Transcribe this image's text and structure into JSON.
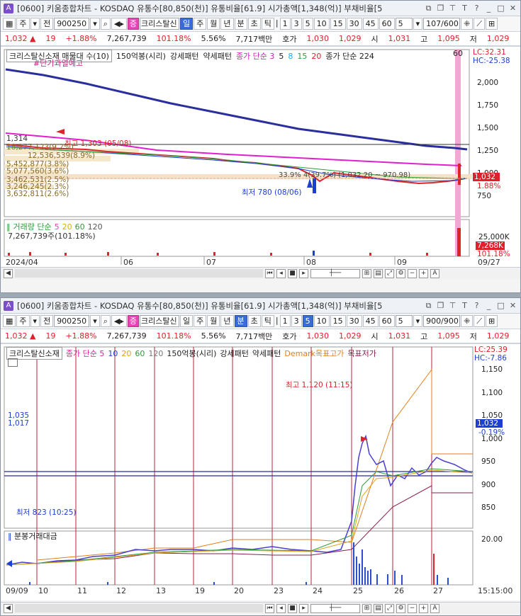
{
  "top": {
    "title": "[0600] 키움종합차트 - KOSDAQ 유통수[80,850(천)] 유통비율[61.9] 시가총액[1,348(억)] 부채비율[5",
    "toolbar": {
      "ju": "주",
      "jeon": "전",
      "code": "900250",
      "name": "크리스탈신",
      "periods": [
        "일",
        "주",
        "월",
        "년",
        "분",
        "초",
        "틱"
      ],
      "selected_period": "일",
      "intervals": [
        "1",
        "3",
        "5",
        "10",
        "15",
        "30",
        "45",
        "60"
      ],
      "count_select": "5",
      "page": "107/600"
    },
    "quote": {
      "price": "1,032",
      "arrow": "▲",
      "change": "19",
      "pct": "+1.88%",
      "volume": "7,267,739",
      "vol_ratio": "101.18%",
      "turnover": "5.56%",
      "amount": "7,717백만",
      "hoga": "호가",
      "hoga_price": "1,030",
      "bid": "1,029",
      "si": "시",
      "open": "1,031",
      "go": "고",
      "high": "1,095",
      "jeo": "저",
      "low": "1,029"
    },
    "legend": {
      "name": "크리스탈신소재 매물대 수(10)",
      "bong": "150억봉(시리)",
      "strong": "강세패턴",
      "weak": "약세패턴",
      "ma_label": "종가 단순 3",
      "ma5": "5",
      "ma8": "8",
      "ma15": "15",
      "ma20": "20",
      "ma224": "종가 단순 224",
      "ma60": "60",
      "warn": "#단기과열예고"
    },
    "lc": "LC:32.31",
    "hc": "HC:-25.38",
    "price_axis": [
      "2,000",
      "1,750",
      "1,500",
      "1,250",
      "1,000",
      "750"
    ],
    "price_tag": "1,032",
    "pct_tag": "1.88%",
    "high_ann": "최고 1,303 (05/08)",
    "low_ann": "최저 780 (08/06)",
    "range_ann": "33.9% 4(39.7%) (1,032.20 ~ 970.98)",
    "left_marks": [
      "1,314",
      "18,277,123(9.2%)",
      "12,536,539(8.9%)",
      "5,452,877(3.8%)",
      "5,077,560(3.6%)",
      "3,462,531(2.5%)",
      "3,246,245(2.3%)",
      "3,632,811(2.6%)"
    ],
    "vol_legend": {
      "label": "거래량 단순",
      "ma5": "5",
      "ma20": "20",
      "ma60": "60",
      "ma120": "120",
      "value": "7,267,739주(101.18%)"
    },
    "vol_axis": "25,000K",
    "vol_tag": "7,268K",
    "vol_pct": "101.18%",
    "dates": [
      "2024/04",
      "06",
      "07",
      "08",
      "09",
      "09/27"
    ]
  },
  "bottom": {
    "title": "[0600] 키움종합차트 - KOSDAQ 유통수[80,850(천)] 유통비율[61.9] 시가총액[1,348(억)] 부채비율[5",
    "toolbar": {
      "ju": "주",
      "jeon": "전",
      "code": "900250",
      "name": "크리스탈신",
      "periods": [
        "일",
        "주",
        "월",
        "년",
        "분",
        "초",
        "틱"
      ],
      "selected_period": "분",
      "intervals": [
        "1",
        "3",
        "5",
        "10",
        "15",
        "30",
        "45",
        "60"
      ],
      "selected_interval": "5",
      "count_select": "5",
      "page": "900/900"
    },
    "quote": {
      "price": "1,032",
      "arrow": "▲",
      "change": "19",
      "pct": "+1.88%",
      "volume": "7,267,739",
      "vol_ratio": "101.18%",
      "turnover": "5.56%",
      "amount": "7,717백만",
      "hoga": "호가",
      "hoga_price": "1,030",
      "bid": "1,029",
      "si": "시",
      "open": "1,031",
      "go": "고",
      "high": "1,095",
      "jeo": "저",
      "low": "1,029"
    },
    "legend": {
      "name": "크리스탈신소재",
      "ma_label": "종가 단순 5",
      "ma10": "10",
      "ma20": "20",
      "ma60": "60",
      "ma120": "120",
      "bong": "150억봉(시리)",
      "strong": "강세패턴",
      "weak": "약세패턴",
      "demark": "Demark목표고가",
      "demark_low": "목표저가"
    },
    "lc": "LC:25.39",
    "hc": "HC:-7.86",
    "price_axis": [
      "1,150",
      "1,100",
      "1,050",
      "1,000",
      "950",
      "900",
      "850"
    ],
    "price_tag": "1,032",
    "pct_tag": "-0.19%",
    "left_marks": [
      "1,035",
      "1,017"
    ],
    "high_ann": "최고 1,120 (11:15)",
    "low_ann": "최저 823 (10:25)",
    "vol_label": "분봉거래대금",
    "vol_axis": "20.00",
    "dates": [
      "09/09",
      "10",
      "11",
      "12",
      "13",
      "19",
      "20",
      "23",
      "24",
      "25",
      "26",
      "27",
      "15:15:00"
    ]
  }
}
